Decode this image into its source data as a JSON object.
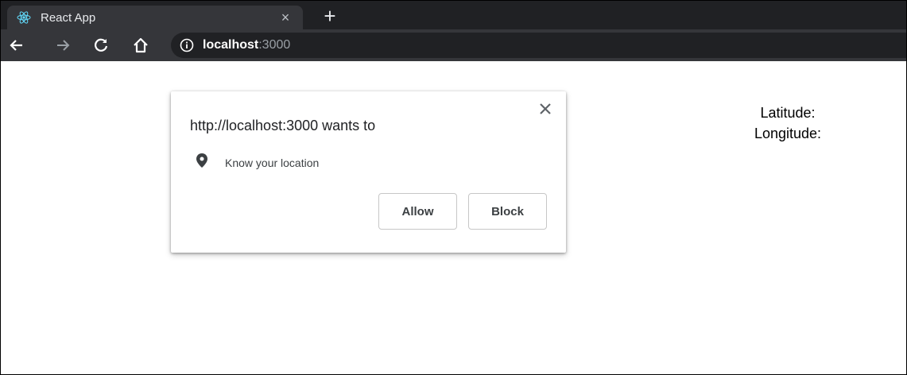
{
  "tab": {
    "title": "React App",
    "close_glyph": "×",
    "favicon": "react-icon",
    "favicon_color": "#61dafb"
  },
  "newtab_glyph": "+",
  "toolbar": {
    "back": "arrow-left-icon",
    "forward": "arrow-right-icon",
    "reload": "reload-icon",
    "home": "home-icon"
  },
  "omnibox": {
    "host": "localhost",
    "port": ":3000",
    "site_info_icon": "info-icon"
  },
  "popup": {
    "title": "http://localhost:3000 wants to",
    "permission_icon": "location-pin-icon",
    "permission_text": "Know your location",
    "allow_label": "Allow",
    "block_label": "Block"
  },
  "page": {
    "latitude_label": "Latitude:",
    "longitude_label": "Longitude:"
  },
  "colors": {
    "tabstrip_bg": "#202124",
    "toolbar_bg": "#35363a",
    "omnibox_bg": "#202124"
  }
}
